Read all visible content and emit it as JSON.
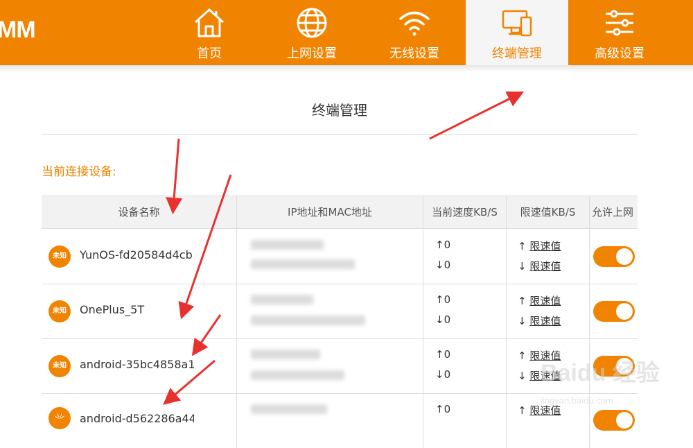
{
  "brand": {
    "logo_text": "MM"
  },
  "nav": {
    "items": [
      {
        "label": "首页",
        "icon": "home-icon"
      },
      {
        "label": "上网设置",
        "icon": "globe-icon"
      },
      {
        "label": "无线设置",
        "icon": "wifi-icon"
      },
      {
        "label": "终端管理",
        "icon": "devices-icon",
        "active": true
      },
      {
        "label": "高级设置",
        "icon": "sliders-icon"
      }
    ]
  },
  "page": {
    "title": "终端管理",
    "section_label": "当前连接设备:"
  },
  "table": {
    "headers": [
      "设备名称",
      "IP地址和MAC地址",
      "当前速度KB/S",
      "限速值KB/S",
      "允许上网"
    ],
    "rows": [
      {
        "badge": "未知",
        "name": "YunOS-fd20584d4cb",
        "up_speed": "↑0",
        "down_speed": "↓0",
        "up_limit_arrow": "↑",
        "up_limit": "限速值",
        "down_limit_arrow": "↓",
        "down_limit": "限速值",
        "allowed": true
      },
      {
        "badge": "未知",
        "name": "OnePlus_5T",
        "up_speed": "↑0",
        "down_speed": "↓0",
        "up_limit_arrow": "↑",
        "up_limit": "限速值",
        "down_limit_arrow": "↓",
        "down_limit": "限速值",
        "allowed": true
      },
      {
        "badge": "未知",
        "name": "android-35bc4858a1",
        "up_speed": "↑0",
        "down_speed": "↓0",
        "up_limit_arrow": "↑",
        "up_limit": "限速值",
        "down_limit_arrow": "↓",
        "down_limit": "限速值",
        "allowed": true
      },
      {
        "badge": "",
        "name": "android-d562286a44",
        "up_speed": "↑0",
        "down_speed": "",
        "up_limit_arrow": "↑",
        "up_limit": "限速值",
        "down_limit_arrow": "",
        "down_limit": "",
        "allowed": true
      }
    ]
  },
  "watermark": {
    "brand": "Baidu 经验",
    "url": "jingyan.baidu.com"
  },
  "colors": {
    "accent": "#f08300",
    "arrow": "#e8312f",
    "header_bg": "#f2f2f2"
  }
}
